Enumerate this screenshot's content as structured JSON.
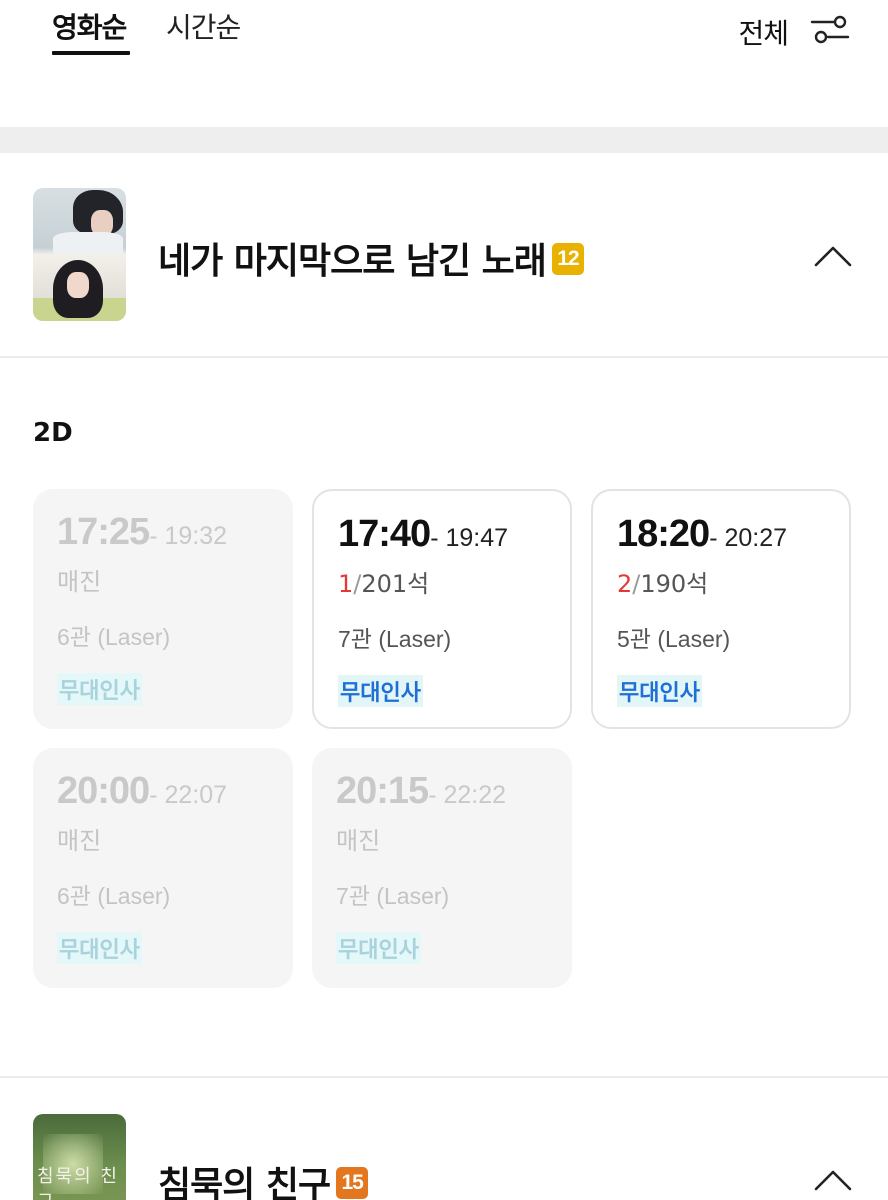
{
  "tabs": {
    "movie_order": "영화순",
    "time_order": "시간순"
  },
  "filter": {
    "label": "전체",
    "icon": "filter-sliders-icon"
  },
  "movies": [
    {
      "title": "네가 마지막으로 남긴 노래",
      "rating": "12",
      "rating_color": "#e9b200",
      "expanded": true,
      "format": "2D",
      "showtimes": [
        {
          "start": "17:25",
          "end": "- 19:32",
          "status": "매진",
          "remaining": "",
          "separator": "",
          "total": "",
          "screen": "6관 (Laser)",
          "tag": "무대인사",
          "sold_out": true
        },
        {
          "start": "17:40",
          "end": "- 19:47",
          "status": "",
          "remaining": "1",
          "separator": "/",
          "total": "201석",
          "screen": "7관 (Laser)",
          "tag": "무대인사",
          "sold_out": false
        },
        {
          "start": "18:20",
          "end": "- 20:27",
          "status": "",
          "remaining": "2",
          "separator": "/",
          "total": "190석",
          "screen": "5관 (Laser)",
          "tag": "무대인사",
          "sold_out": false
        },
        {
          "start": "20:00",
          "end": "- 22:07",
          "status": "매진",
          "remaining": "",
          "separator": "",
          "total": "",
          "screen": "6관 (Laser)",
          "tag": "무대인사",
          "sold_out": true
        },
        {
          "start": "20:15",
          "end": "- 22:22",
          "status": "매진",
          "remaining": "",
          "separator": "",
          "total": "",
          "screen": "7관 (Laser)",
          "tag": "무대인사",
          "sold_out": true
        }
      ]
    },
    {
      "title": "침묵의 친구",
      "rating": "15",
      "rating_color": "#e2771f",
      "poster_text": "침묵의 친구",
      "expanded": false
    }
  ],
  "colors": {
    "accent_blue": "#1f6fd6",
    "remaining_red": "#e53935",
    "sold_out_gray": "#c9c9c9"
  }
}
